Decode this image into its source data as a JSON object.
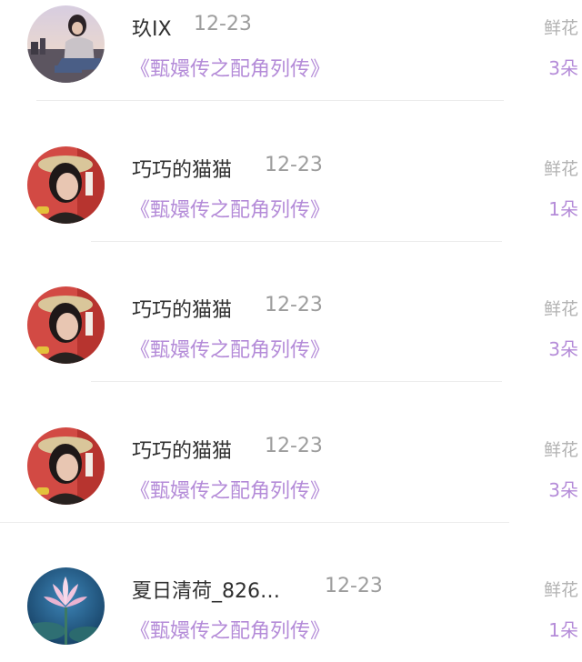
{
  "items": [
    {
      "avatar_icon": "user-avatar-photo-girl-city",
      "name": "玖IX",
      "date": "12-23",
      "book": "《甄嬛传之配角列传》",
      "gift_label": "鲜花",
      "gift_count": "3朵"
    },
    {
      "avatar_icon": "user-avatar-photo-woman-hat",
      "name": "巧巧的猫猫",
      "date": "12-23",
      "book": "《甄嬛传之配角列传》",
      "gift_label": "鲜花",
      "gift_count": "1朵"
    },
    {
      "avatar_icon": "user-avatar-photo-woman-hat",
      "name": "巧巧的猫猫",
      "date": "12-23",
      "book": "《甄嬛传之配角列传》",
      "gift_label": "鲜花",
      "gift_count": "3朵"
    },
    {
      "avatar_icon": "user-avatar-photo-woman-hat",
      "name": "巧巧的猫猫",
      "date": "12-23",
      "book": "《甄嬛传之配角列传》",
      "gift_label": "鲜花",
      "gift_count": "3朵"
    },
    {
      "avatar_icon": "user-avatar-photo-lotus",
      "name": "夏日清荷_826…",
      "date": "12-23",
      "book": "《甄嬛传之配角列传》",
      "gift_label": "鲜花",
      "gift_count": "1朵"
    }
  ],
  "colors": {
    "book_title": "#b48bd8",
    "gift_count": "#b48bd8",
    "name": "#2f2f2f",
    "date": "#9d9d9d",
    "gift_label": "#b2b2b2"
  }
}
